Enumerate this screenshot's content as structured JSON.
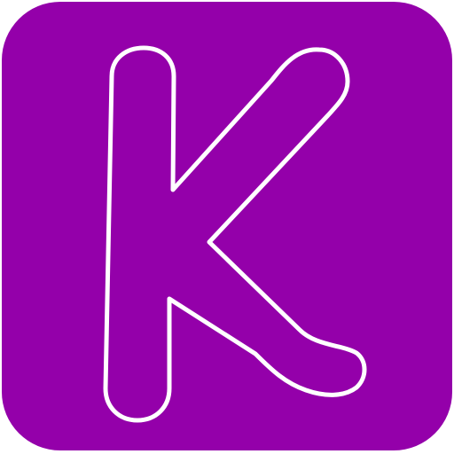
{
  "app_icon": {
    "letter": "K",
    "background_color": "#9400aa",
    "outline_color": "#ffffff",
    "glyph_style": "outlined-letter"
  }
}
